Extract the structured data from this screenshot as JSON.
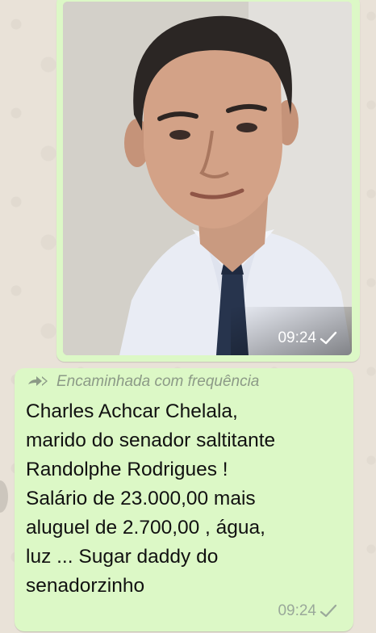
{
  "image_message": {
    "photo_description": "portrait photo",
    "time": "09:24"
  },
  "text_message": {
    "forwarded_label": "Encaminhada com frequência",
    "body": "Charles Achcar Chelala,\nmarido do senador saltitante\nRandolphe Rodrigues !\nSalário de 23.000,00 mais\naluguel de 2.700,00  , água,\nluz ... Sugar daddy do\nsenadorzinho",
    "time": "09:24"
  },
  "colors": {
    "bubble_outgoing": "#dcf8c6",
    "wallpaper": "#ece5dd",
    "meta_text": "#9aa89a"
  },
  "icons": {
    "forward": "double-arrow-forward-icon",
    "sent": "single-check-icon"
  }
}
